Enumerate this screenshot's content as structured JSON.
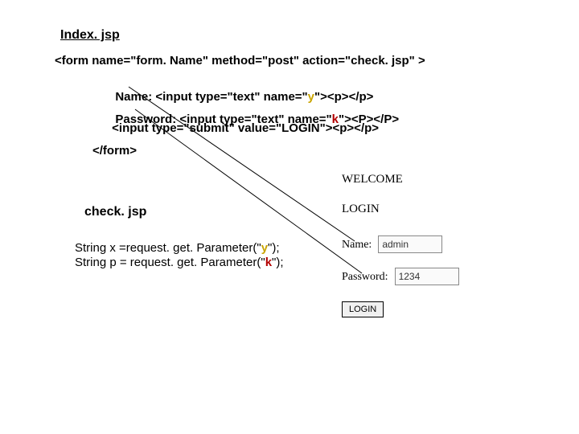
{
  "titles": {
    "index": "Index. jsp",
    "check": "check. jsp"
  },
  "index_src": {
    "l1a": "<form name=\"form. Name\" method=\"post\" action=\"check. jsp\" >",
    "l2a": "Name: <input type=\"text\" name=\"",
    "l2y": "y",
    "l2b": "\"><p></p>",
    "l3a": "Password: <input type=\"text\" name=\"",
    "l3k": "k",
    "l3b": "\"><P></P>",
    "l4": " <input type=\"submit\" value=\"LOGIN\"><p></p>",
    "l5": "</form>"
  },
  "check_src": {
    "l1a": "String x =request. get. Parameter(\"",
    "l1y": "y",
    "l1b": "\");",
    "l2a": "String p = request. get. Parameter(\"",
    "l2k": "k",
    "l2b": "\");"
  },
  "form": {
    "welcome": "WELCOME",
    "login_head": "LOGIN",
    "name_label": "Name:",
    "pass_label": "Password:",
    "name_value": "admin",
    "pass_value": "1234",
    "button": "LOGIN"
  }
}
